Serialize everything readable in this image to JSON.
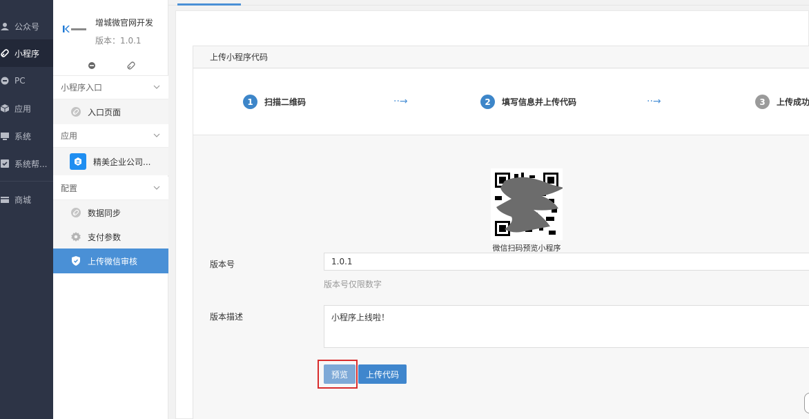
{
  "nav": {
    "items": [
      {
        "label": "公众号",
        "icon": "user-icon"
      },
      {
        "label": "小程序",
        "icon": "link-icon",
        "active": true
      },
      {
        "label": "PC",
        "icon": "circle-icon"
      },
      {
        "label": "应用",
        "icon": "cube-icon"
      },
      {
        "label": "系统",
        "icon": "monitor-icon"
      },
      {
        "label": "系统帮...",
        "icon": "help-icon"
      },
      {
        "label": "商城",
        "icon": "store-icon"
      }
    ]
  },
  "sidebar": {
    "brand_name": "增城微官网开发",
    "version": "版本：1.0.1",
    "sections": [
      {
        "title": "小程序入口",
        "items": [
          {
            "label": "入口页面",
            "icon": "link-icon"
          }
        ]
      },
      {
        "title": "应用",
        "items": [
          {
            "label": "精美企业公司...",
            "icon": "app-icon"
          }
        ]
      },
      {
        "title": "配置",
        "items": [
          {
            "label": "数据同步",
            "icon": "sync-icon"
          },
          {
            "label": "支付参数",
            "icon": "gear-icon"
          },
          {
            "label": "上传微信审核",
            "icon": "shield-icon",
            "active": true
          }
        ]
      }
    ]
  },
  "main": {
    "panel_title": "上传小程序代码",
    "steps": [
      {
        "num": "1",
        "label": "扫描二维码",
        "color": "#3d86c9"
      },
      {
        "num": "2",
        "label": "填写信息并上传代码",
        "color": "#3d86c9"
      },
      {
        "num": "3",
        "label": "上传成功",
        "color": "#9a9a9a"
      }
    ],
    "arrow": "··→",
    "qr_caption": "微信扫码预览小程序",
    "version_label": "版本号",
    "version_value": "1.0.1",
    "version_hint": "版本号仅限数字",
    "desc_label": "版本描述",
    "desc_value": "小程序上线啦！",
    "preview_button": "预览",
    "upload_button": "上传代码"
  },
  "colors": {
    "accent": "#4a90d6",
    "nav_bg": "#2d3446",
    "highlight": "#d82c2c"
  }
}
